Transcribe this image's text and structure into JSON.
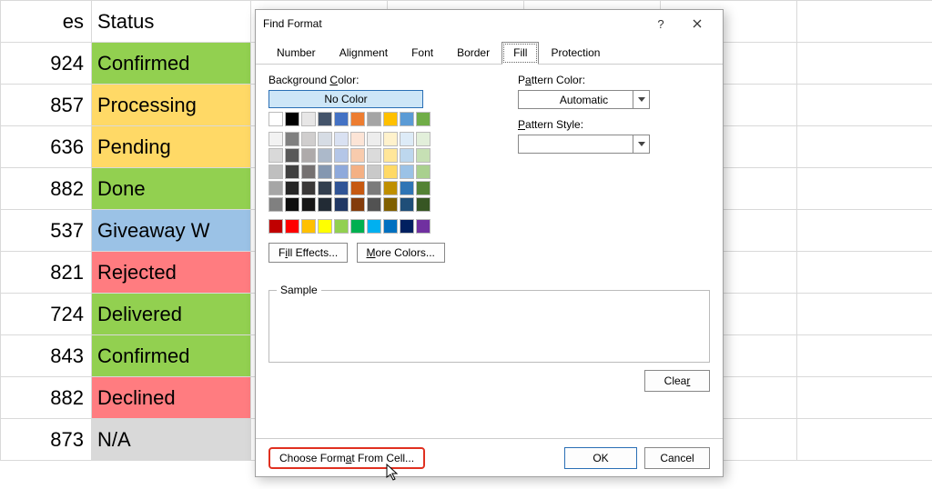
{
  "sheet": {
    "headers": {
      "a": "es",
      "b": "Status"
    },
    "rows": [
      {
        "num": "924",
        "status": "Confirmed",
        "fill": "green"
      },
      {
        "num": "857",
        "status": "Processing",
        "fill": "yellow"
      },
      {
        "num": "636",
        "status": "Pending",
        "fill": "yellow"
      },
      {
        "num": "882",
        "status": "Done",
        "fill": "green"
      },
      {
        "num": "537",
        "status": "Giveaway W",
        "fill": "blue"
      },
      {
        "num": "821",
        "status": "Rejected",
        "fill": "red"
      },
      {
        "num": "724",
        "status": "Delivered",
        "fill": "green"
      },
      {
        "num": "843",
        "status": "Confirmed",
        "fill": "green"
      },
      {
        "num": "882",
        "status": "Declined",
        "fill": "red"
      },
      {
        "num": "873",
        "status": "N/A",
        "fill": "gray"
      }
    ]
  },
  "dialog": {
    "title": "Find Format",
    "help": "?",
    "tabs": [
      "Number",
      "Alignment",
      "Font",
      "Border",
      "Fill",
      "Protection"
    ],
    "active_tab": "Fill",
    "bg_label": "Background Color:",
    "no_color": "No Color",
    "fill_effects": "Fill Effects...",
    "more_colors": "More Colors...",
    "pattern_color_label": "Pattern Color:",
    "pattern_color_value": "Automatic",
    "pattern_style_label": "Pattern Style:",
    "sample_label": "Sample",
    "clear": "Clear",
    "choose_format": "Choose Format From Cell...",
    "ok": "OK",
    "cancel": "Cancel"
  },
  "palettes": {
    "theme_row": [
      "#ffffff",
      "#000000",
      "#e7e6e6",
      "#44546a",
      "#4472c4",
      "#ed7d31",
      "#a5a5a5",
      "#ffc000",
      "#5b9bd5",
      "#70ad47"
    ],
    "theme_shades": [
      [
        "#f2f2f2",
        "#808080",
        "#d0cece",
        "#d6dce4",
        "#d9e1f2",
        "#fce4d6",
        "#ededed",
        "#fff2cc",
        "#ddebf7",
        "#e2efda"
      ],
      [
        "#d9d9d9",
        "#595959",
        "#aeaaaa",
        "#acb9ca",
        "#b4c6e7",
        "#f8cbad",
        "#dbdbdb",
        "#ffe699",
        "#bdd7ee",
        "#c6e0b4"
      ],
      [
        "#bfbfbf",
        "#404040",
        "#757171",
        "#8497b0",
        "#8ea9db",
        "#f4b084",
        "#c9c9c9",
        "#ffd966",
        "#9bc2e6",
        "#a9d08e"
      ],
      [
        "#a6a6a6",
        "#262626",
        "#3a3838",
        "#333f4f",
        "#305496",
        "#c65911",
        "#7b7b7b",
        "#bf8f00",
        "#2f75b5",
        "#548235"
      ],
      [
        "#808080",
        "#0d0d0d",
        "#161616",
        "#222b35",
        "#203764",
        "#833c0c",
        "#525252",
        "#806000",
        "#1f4e78",
        "#375623"
      ]
    ],
    "standard": [
      "#c00000",
      "#ff0000",
      "#ffc000",
      "#ffff00",
      "#92d050",
      "#00b050",
      "#00b0f0",
      "#0070c0",
      "#002060",
      "#7030a0"
    ]
  }
}
